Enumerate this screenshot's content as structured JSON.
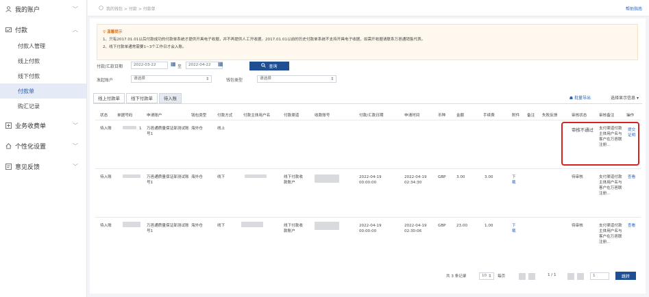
{
  "sidebar": {
    "account": "我的账户",
    "payment": "付款",
    "payment_items": [
      "付款人管理",
      "线上付款",
      "线下付款",
      "付款单",
      "购汇记录"
    ],
    "business": "业务收费单",
    "personal": "个性化设置",
    "feedback": "意见反馈"
  },
  "topbar": {
    "breadcrumb": "我的钱包 > 付款 > 付款单",
    "help": "帮助指南"
  },
  "notice": {
    "title": "温馨提示",
    "line1": "1、只有2017.01.01以后付款成功的付款单系统才提供开具电子收据，并不再提供人工开收据。2017.01.01以前的历史付款单系统不支持开具电子收据，如需开收据请联系万邑通销售代表。",
    "line2": "2、线下付款单通常需要1~3个工作日才会入账。"
  },
  "filters": {
    "date_label": "付款/汇款日期",
    "date_from": "2022-03-22",
    "to": "至",
    "date_to": "2022-04-22",
    "query": "查询",
    "account_label": "发起账户",
    "account_value": "请选择",
    "wallet_label": "钱包类型",
    "wallet_value": "请选择"
  },
  "tabs": [
    "线上付款单",
    "线下付款单",
    "待入账"
  ],
  "toolbar": {
    "export": "批量导出",
    "select_info": "选择显示信息"
  },
  "table": {
    "headers": [
      "状态",
      "单据号码",
      "申请账户",
      "钱包类型",
      "付款方式",
      "付款主体用户名",
      "付款渠道",
      "收款账号",
      "付款/汇款日期",
      "申请时间",
      "币种",
      "金额",
      "手续费",
      "附件",
      "备注",
      "失败反馈",
      "审核状态",
      "审核备注",
      "操作"
    ],
    "rows": [
      {
        "status": "待入账",
        "doc_no": "1",
        "account": "万邑通质量保证部测试账号1",
        "wallet": "海外仓",
        "method": "线上",
        "channel": "",
        "pay_date": "",
        "apply_time": "",
        "currency": "",
        "amount": "",
        "fee": "",
        "attachment": "",
        "audit_status": "审核不通过",
        "audit_note": "支付渠道付款主体用户名与客户在万邑联注册...",
        "action": "提交证明"
      },
      {
        "status": "待入账",
        "doc_no": "",
        "account": "万邑通质量保证部测试账号1",
        "wallet": "海外仓",
        "method": "线下",
        "channel": "线下付款收款账户",
        "pay_date": "2022-04-19 00:00:00",
        "apply_time": "2022-04-19 02:34:30",
        "currency": "GBP",
        "amount": "3.00",
        "fee": "3.00",
        "attachment": "下载",
        "audit_status": "待审核",
        "audit_note": "支付渠道付款主体用户名与客户在万邑联注册...",
        "action": "查看"
      },
      {
        "status": "待入账",
        "doc_no": "",
        "account": "万邑通质量保证部测试账号1",
        "wallet": "海外仓",
        "method": "线下",
        "channel": "线下付款收款账户",
        "pay_date": "2022-04-19 00:00:00",
        "apply_time": "2022-04-19 02:30:06",
        "currency": "GBP",
        "amount": "23.00",
        "fee": "1.00",
        "attachment": "下载",
        "audit_status": "待审核",
        "audit_note": "支付渠道付款主体用户名与客户在万邑联注册...",
        "action": "查看"
      }
    ]
  },
  "pager": {
    "total": "共 3 条记录",
    "page_size": "10",
    "per_page": "每页",
    "page_info": "1 / 1",
    "page_input": "1",
    "jump": "跳转"
  }
}
